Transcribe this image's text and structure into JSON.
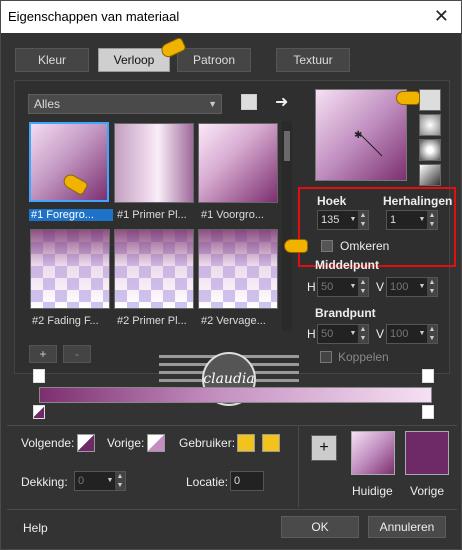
{
  "window": {
    "title": "Eigenschappen van materiaal",
    "close_label": "✕"
  },
  "tabs": [
    {
      "label": "Kleur",
      "active": false
    },
    {
      "label": "Verloop",
      "active": true
    },
    {
      "label": "Patroon",
      "active": false
    },
    {
      "label": "Textuur",
      "active": false
    }
  ],
  "category": {
    "selected": "Alles"
  },
  "gradients": [
    {
      "label": "#1 Foregro...",
      "selected": true
    },
    {
      "label": "#1 Primer Pl...",
      "selected": false
    },
    {
      "label": "#1 Voorgro...",
      "selected": false
    },
    {
      "label": "#2 Fading F...",
      "selected": false
    },
    {
      "label": "#2 Primer Pl...",
      "selected": false
    },
    {
      "label": "#2 Vervage...",
      "selected": false
    }
  ],
  "settings": {
    "hoek_label": "Hoek",
    "hoek_value": "135",
    "herhalingen_label": "Herhalingen",
    "herhalingen_value": "1",
    "omkeren_label": "Omkeren",
    "middelpunt_label": "Middelpunt",
    "middelpunt_h_label": "H",
    "middelpunt_h": "50",
    "middelpunt_v_label": "V",
    "middelpunt_v": "100",
    "brandpunt_label": "Brandpunt",
    "brandpunt_h_label": "H",
    "brandpunt_h": "50",
    "brandpunt_v_label": "V",
    "brandpunt_v": "100",
    "koppelen_label": "Koppelen"
  },
  "editor": {
    "add_label": "+",
    "remove_label": "-",
    "watermark_text": "claudia"
  },
  "stops": {
    "volgende_label": "Volgende:",
    "vorige_label": "Vorige:",
    "gebruiker_label": "Gebruiker:",
    "dekking_label": "Dekking:",
    "dekking_value": "0",
    "locatie_label": "Locatie:",
    "locatie_value": "0"
  },
  "swatches": {
    "add_label": "+",
    "huidige_label": "Huidige",
    "vorige_label": "Vorige"
  },
  "footer": {
    "help_label": "Help",
    "ok_label": "OK",
    "cancel_label": "Annuleren"
  },
  "colors": {
    "dark_purple": "#6e2a66",
    "light_pink": "#f6e0f3",
    "gold": "#f2c31c",
    "accent_blue": "#1e72c8",
    "highlight_red": "#e01010"
  }
}
